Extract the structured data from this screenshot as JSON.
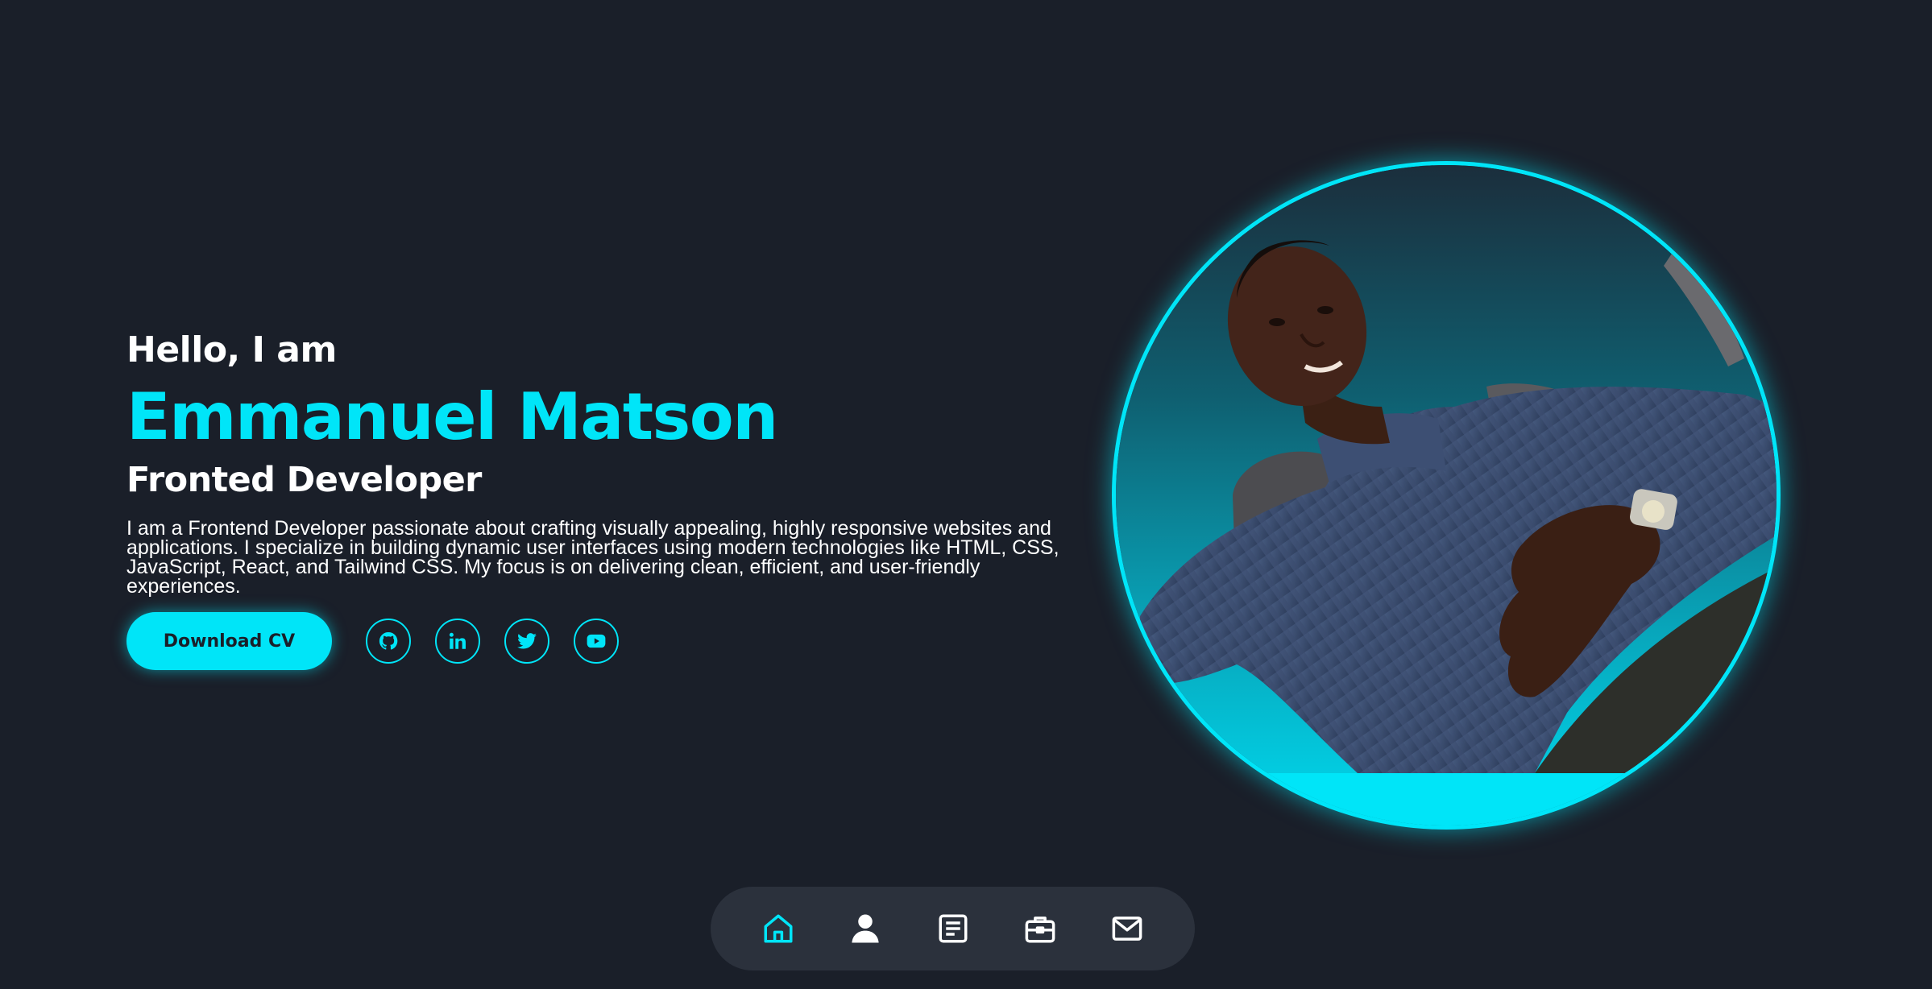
{
  "hero": {
    "greeting": "Hello, I am",
    "name": "Emmanuel Matson",
    "role": "Fronted Developer",
    "bio": "I am a Frontend Developer passionate about crafting visually appealing, highly responsive websites and applications. I specialize in building dynamic user interfaces using modern technologies like HTML, CSS, JavaScript, React, and Tailwind CSS. My focus is on delivering clean, efficient, and user-friendly experiences."
  },
  "actions": {
    "download_label": "Download CV",
    "socials": [
      {
        "icon": "github-icon"
      },
      {
        "icon": "linkedin-icon"
      },
      {
        "icon": "twitter-icon"
      },
      {
        "icon": "youtube-icon"
      }
    ]
  },
  "portrait": {
    "image": "profile-photo"
  },
  "nav": {
    "items": [
      {
        "icon": "home-icon",
        "active": true
      },
      {
        "icon": "user-icon",
        "active": false
      },
      {
        "icon": "document-icon",
        "active": false
      },
      {
        "icon": "briefcase-icon",
        "active": false
      },
      {
        "icon": "mail-icon",
        "active": false
      }
    ]
  },
  "colors": {
    "background": "#1a1f29",
    "accent": "#00e5f8",
    "nav_background": "#2b313c",
    "text": "#ffffff"
  }
}
